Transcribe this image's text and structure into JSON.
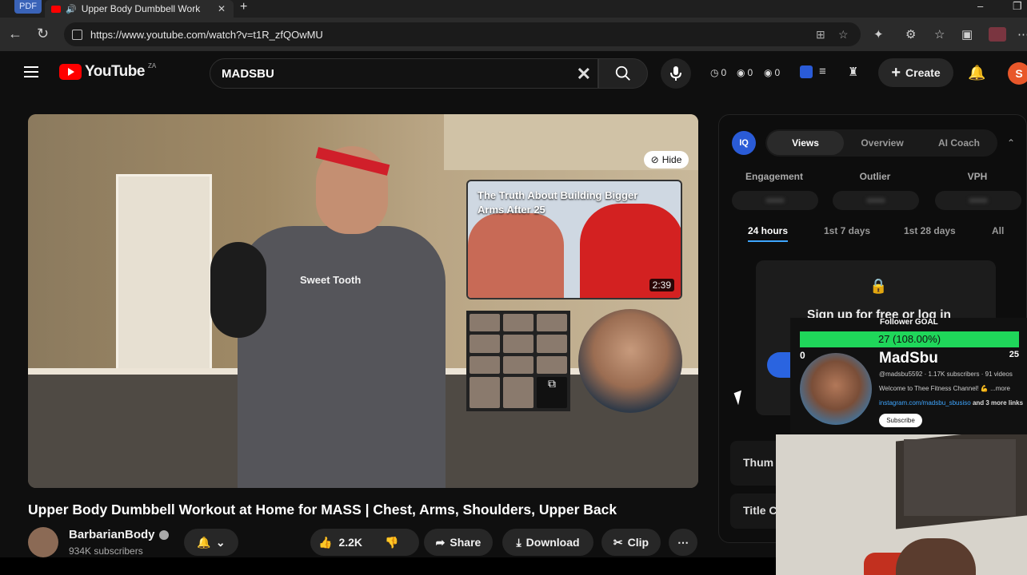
{
  "browser": {
    "pdf_label": "PDF",
    "tab_title": "Upper Body Dumbbell Work",
    "url": "https://www.youtube.com/watch?v=t1R_zfQOwMU"
  },
  "header": {
    "logo_text": "YouTube",
    "country_code": "ZA",
    "search_value": "MADSBU",
    "stats": [
      "0",
      "0",
      "0"
    ],
    "create_label": "Create",
    "avatar_letter": "S"
  },
  "video": {
    "hide_label": "Hide",
    "shirt_text": "Sweet Tooth",
    "endcard_title": "The Truth About Building Bigger Arms After 25",
    "endcard_duration": "2:39"
  },
  "info": {
    "title": "Upper Body Dumbbell Workout at Home for MASS | Chest, Arms, Shoulders, Upper Back",
    "channel": "BarbarianBody",
    "subscribers": "934K subscribers",
    "like_count": "2.2K",
    "share_label": "Share",
    "download_label": "Download",
    "clip_label": "Clip"
  },
  "panel": {
    "logo": "IQ",
    "tabs": [
      "Views",
      "Overview",
      "AI Coach"
    ],
    "metrics": [
      "Engagement",
      "Outlier",
      "VPH"
    ],
    "ranges": [
      "24 hours",
      "1st 7 days",
      "1st 28 days",
      "All"
    ],
    "lock_message": "Sign up for free or log in",
    "row_thumb": "Thum",
    "row_title": "Title C"
  },
  "goal": {
    "title": "Follower GOAL",
    "progress_text": "27 (108.00%)",
    "progress": 1.0,
    "min": "0",
    "max": "25",
    "name": "MadSbu",
    "meta": "@madsbu5592 · 1.17K subscribers · 91 videos",
    "desc": "Welcome to Thee Fitness Channel! 💪 ...more",
    "link": "instagram.com/madsbu_sbusiso",
    "link_more": " and 3 more links",
    "subscribe": "Subscribe"
  }
}
